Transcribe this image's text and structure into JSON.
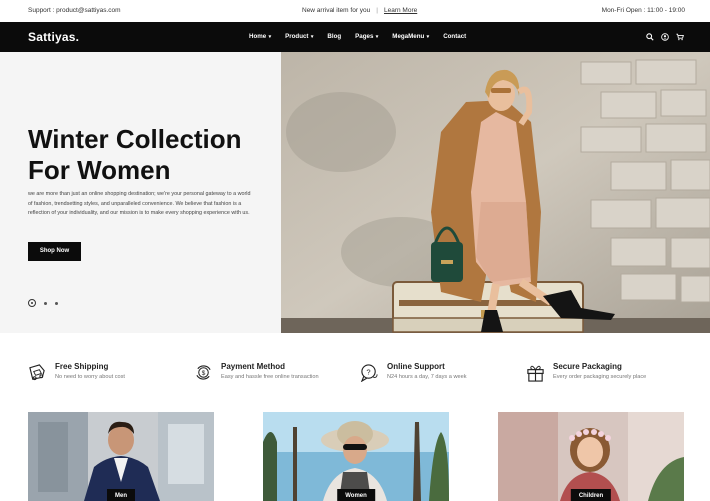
{
  "topbar": {
    "support": "Support : product@sattiyas.com",
    "announcement": "New arrival item for you",
    "learn_more": "Learn More",
    "hours": "Mon-Fri Open : 11:00 - 19:00"
  },
  "brand": {
    "name": "Sattiyas."
  },
  "nav": {
    "items": [
      {
        "label": "Home",
        "dropdown": true
      },
      {
        "label": "Product",
        "dropdown": true
      },
      {
        "label": "Blog",
        "dropdown": false
      },
      {
        "label": "Pages",
        "dropdown": true
      },
      {
        "label": "MegaMenu",
        "dropdown": true
      },
      {
        "label": "Contact",
        "dropdown": false
      }
    ],
    "icons": [
      "search-icon",
      "user-icon",
      "cart-icon"
    ]
  },
  "hero": {
    "title_line1": "Winter Collection",
    "title_line2": "For Women",
    "description": "we are more than just an online shopping destination; we're your personal gateway to a world of fashion, trendsetting styles, and unparalleled convenience. We believe that fashion is a reflection of your individuality, and our mission is to make every shopping experience with us.",
    "button": "Shop Now",
    "slides": 3,
    "active_slide": 1
  },
  "features": [
    {
      "icon": "truck-icon",
      "title": "Free Shipping",
      "subtitle": "No need to worry about cost"
    },
    {
      "icon": "dollar-cycle-icon",
      "title": "Payment Method",
      "subtitle": "Easy and hassle free online transaction"
    },
    {
      "icon": "support-bubble-icon",
      "title": "Online Support",
      "subtitle": "N24 hours a day, 7 days a week"
    },
    {
      "icon": "gift-box-icon",
      "title": "Secure Packaging",
      "subtitle": "Every order packaging securely place"
    }
  ],
  "categories": [
    {
      "label": "Men"
    },
    {
      "label": "Women"
    },
    {
      "label": "Children"
    }
  ],
  "colors": {
    "dark": "#0b0b0b",
    "hero_bg": "#f5f5f5",
    "text_muted": "#777777"
  }
}
